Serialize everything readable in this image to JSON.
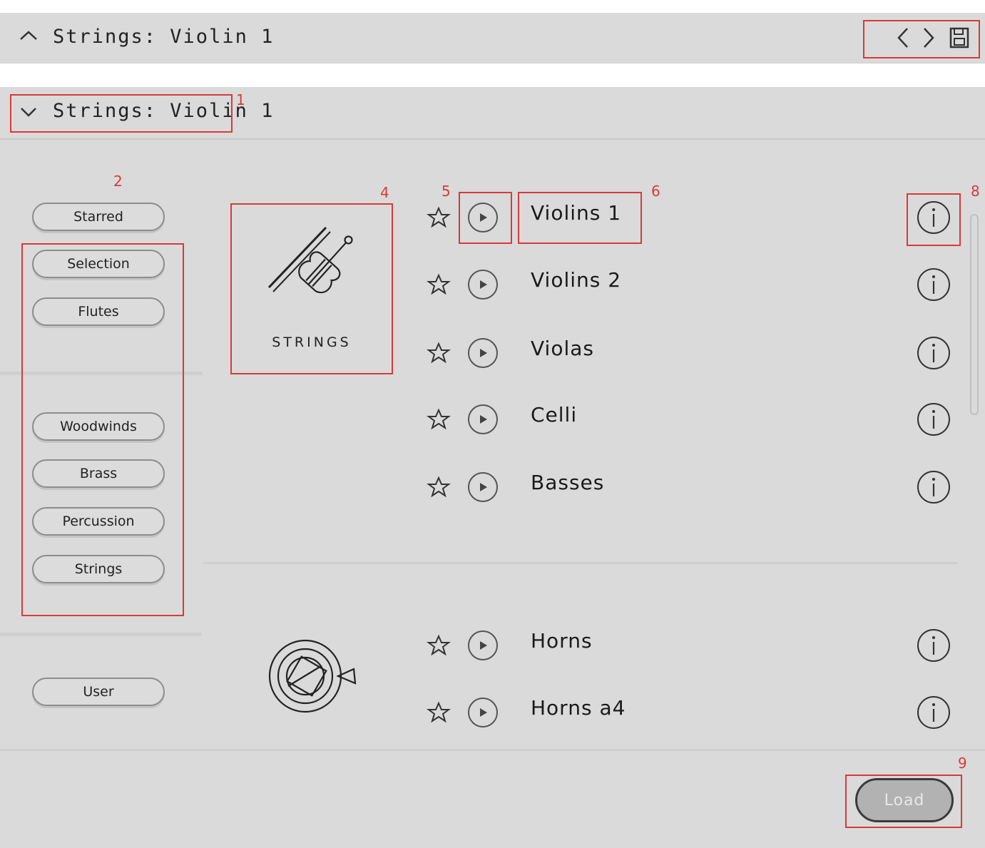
{
  "top_header": {
    "title": "Strings: Violin 1"
  },
  "panel_header": {
    "title": "Strings: Violin 1"
  },
  "sidebar": {
    "starred": "Starred",
    "selection": "Selection",
    "flutes": "Flutes",
    "woodwinds": "Woodwinds",
    "brass": "Brass",
    "percussion": "Percussion",
    "strings": "Strings",
    "user": "User"
  },
  "category_card": {
    "label": "STRINGS",
    "icon": "violin-icon"
  },
  "strings_list": [
    "Violins 1",
    "Violins 2",
    "Violas",
    "Celli",
    "Basses"
  ],
  "brass_list": [
    "Horns",
    "Horns a4"
  ],
  "brass_icon": "french-horn-icon",
  "footer": {
    "load_label": "Load"
  },
  "annotations": [
    "1",
    "2",
    "4",
    "5",
    "6",
    "8",
    "9"
  ],
  "colors": {
    "panel_bg": "#dadada",
    "annotation": "#d83a3a",
    "load_bg": "#b2b2b2"
  }
}
